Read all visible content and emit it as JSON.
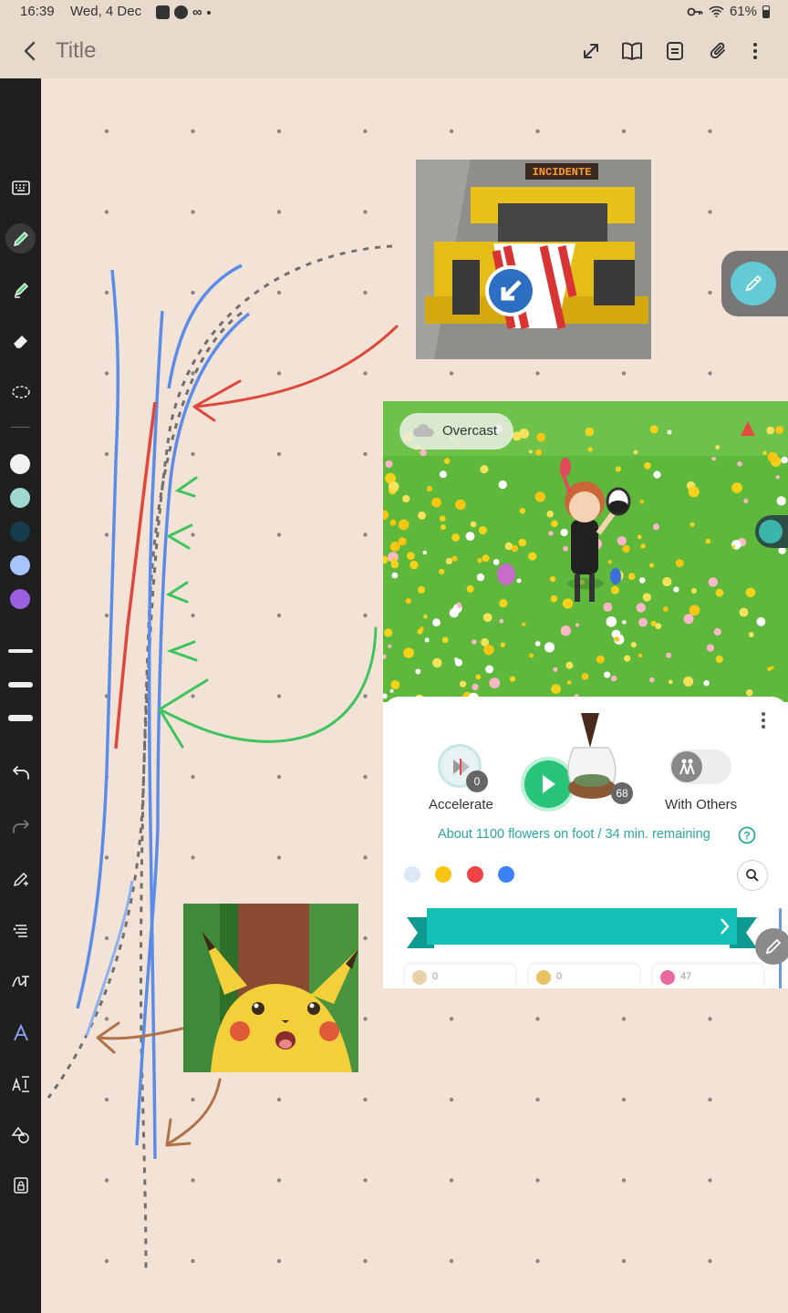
{
  "status_bar": {
    "time": "16:39",
    "date": "Wed, 4 Dec",
    "battery": "61%"
  },
  "app_bar": {
    "title": "Title",
    "icons": [
      "back-icon",
      "expand-icon",
      "book-view-icon",
      "template-icon",
      "attach-icon",
      "more-icon"
    ]
  },
  "left_toolbar": {
    "tools": [
      "keyboard-icon",
      "pen-icon",
      "highlighter-icon",
      "eraser-icon",
      "lasso-icon"
    ],
    "colors": [
      "#f2f2f2",
      "#9fd8cc",
      "#143c4a",
      "#a8c4ff",
      "#9a5fe0"
    ],
    "stroke_sizes": [
      "thin",
      "medium",
      "thick"
    ],
    "actions": [
      "undo-icon",
      "redo-icon",
      "pen-settings-icon",
      "text-align-icon",
      "handwriting-icon",
      "text-style-icon",
      "text-size-icon",
      "shapes-icon",
      "lock-icon"
    ],
    "active_tool": "pen-icon"
  },
  "truck_image": {
    "sign_text": "INCIDENTE"
  },
  "pikmin_screenshot": {
    "weather_label": "Overcast",
    "accelerate_label": "Accelerate",
    "accelerate_count": "0",
    "nectar_count": "68",
    "with_others_label": "With Others",
    "progress_text": "About 1100 flowers on foot / 34 min. remaining",
    "petal_colors": [
      "#dce8f5",
      "#f7c512",
      "#ef4444",
      "#3b82f6"
    ],
    "cards": [
      {
        "count": "0",
        "color": "#e8d3a8"
      },
      {
        "count": "0",
        "color": "#e9c266"
      },
      {
        "count": "47",
        "color": "#e96aa0"
      }
    ],
    "accent_color": "#14bfb5"
  },
  "pikachu_image": {},
  "colors": {
    "background": "#f3e2d6",
    "toolbar": "#1f1f1f",
    "appbar": "#e8d9cd",
    "stroke_blue": "#5b8de8",
    "stroke_red": "#e0473c",
    "stroke_green": "#3ec45c",
    "stroke_brown": "#b0724a",
    "stroke_dashed": "#777777"
  }
}
